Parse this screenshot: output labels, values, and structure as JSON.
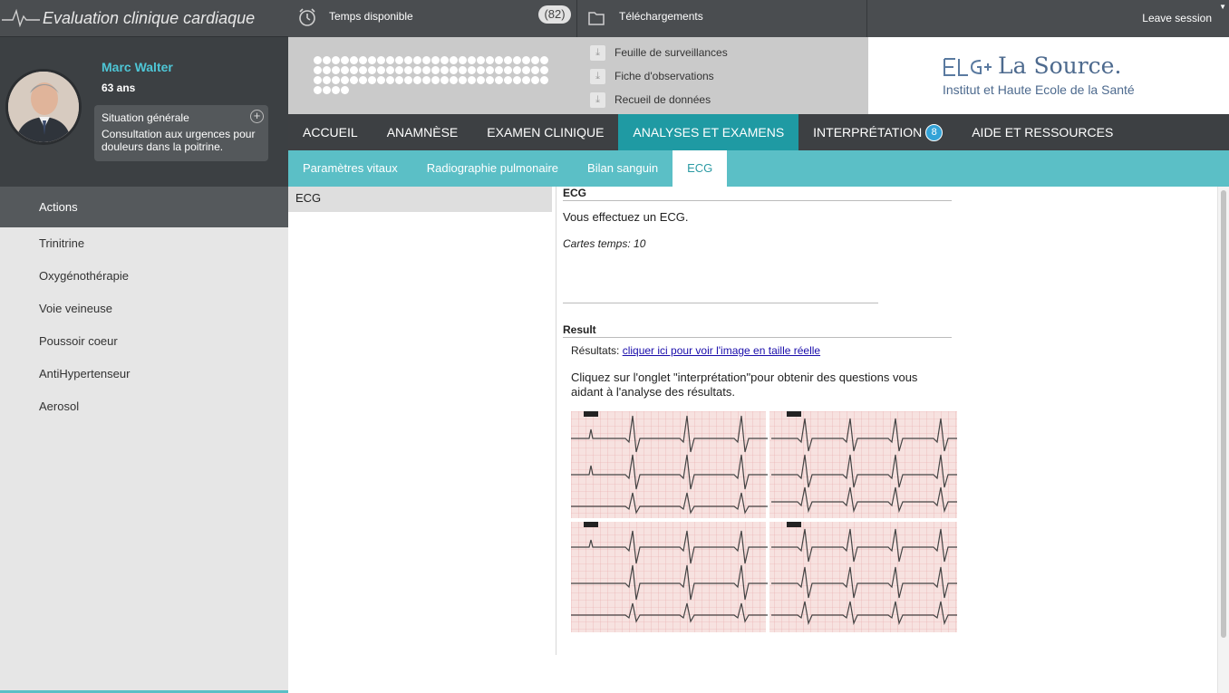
{
  "app": {
    "title": "Evaluation clinique cardiaque",
    "leave_session": "Leave session"
  },
  "patient": {
    "name": "Marc Walter",
    "age": "63 ans",
    "situation_title": "Situation générale",
    "situation_text": "Consultation aux urgences pour douleurs dans la poitrine."
  },
  "header": {
    "time_label": "Temps disponible",
    "time_badge": "(82)",
    "downloads_label": "Téléchargements",
    "downloads": [
      "Feuille de surveillances",
      "Fiche d'observations",
      "Recueil de données"
    ]
  },
  "logo": {
    "name": "La Source.",
    "subtitle": "Institut et Haute Ecole de la Santé"
  },
  "nav": {
    "items": [
      "ACCUEIL",
      "ANAMNÈSE",
      "EXAMEN CLINIQUE",
      "ANALYSES ET EXAMENS",
      "INTERPRÉTATION",
      "AIDE ET RESSOURCES"
    ],
    "active": "ANALYSES ET EXAMENS",
    "interpretation_badge": "8"
  },
  "subnav": {
    "items": [
      "Paramètres vitaux",
      "Radiographie pulmonaire",
      "Bilan sanguin",
      "ECG"
    ],
    "active": "ECG"
  },
  "actions": {
    "header": "Actions",
    "items": [
      "Trinitrine",
      "Oxygénothérapie",
      "Voie veineuse",
      "Poussoir coeur",
      "AntiHypertenseur",
      "Aerosol"
    ]
  },
  "content": {
    "list_item": "ECG",
    "section_title": "ECG",
    "intro": "Vous effectuez un ECG.",
    "cards": "Cartes temps: 10",
    "result_title": "Result",
    "results_prefix": "Résultats: ",
    "results_link": "cliquer ici pour voir l'image en taille réelle",
    "help_text": "Cliquez sur l'onglet \"interprétation\"pour obtenir des questions vous aidant à l'analyse des résultats."
  },
  "colors": {
    "teal": "#1f9aa3",
    "teal_light": "#5bbfc6",
    "dark": "#3d4043",
    "badge_blue": "#34a3d7",
    "patient_name": "#4ec6d6"
  }
}
